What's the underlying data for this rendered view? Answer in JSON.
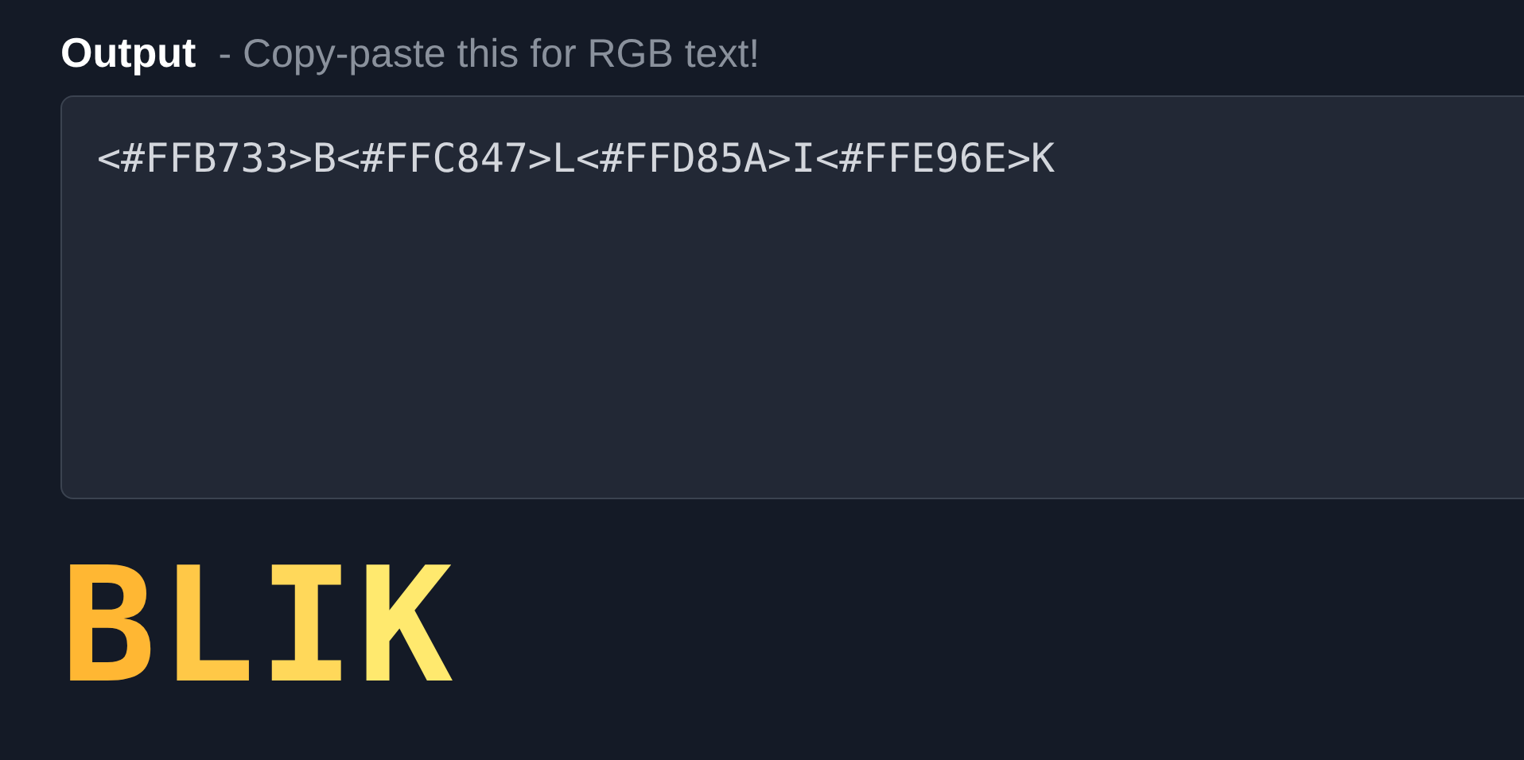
{
  "output": {
    "label": "Output",
    "hint": "- Copy-paste this for RGB text!",
    "value": "<#FFB733>B<#FFC847>L<#FFD85A>I<#FFE96E>K"
  },
  "preview": [
    {
      "char": "B",
      "color": "#ffb733"
    },
    {
      "char": "L",
      "color": "#ffc847"
    },
    {
      "char": "I",
      "color": "#ffd85a"
    },
    {
      "char": "K",
      "color": "#ffe96e"
    }
  ]
}
